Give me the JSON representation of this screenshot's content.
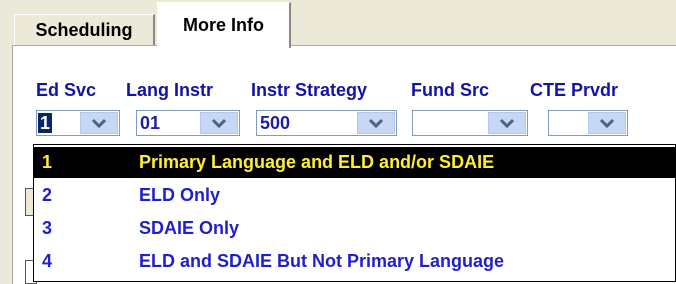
{
  "tabs": [
    {
      "label": "Scheduling"
    },
    {
      "label": "More Info"
    }
  ],
  "fields": [
    {
      "header": "Ed Svc",
      "value": "1"
    },
    {
      "header": "Lang Instr",
      "value": "01"
    },
    {
      "header": "Instr Strategy",
      "value": "500"
    },
    {
      "header": "Fund Src",
      "value": ""
    },
    {
      "header": "CTE Prvdr",
      "value": ""
    }
  ],
  "dropdown": {
    "options": [
      {
        "code": "1",
        "label": "Primary Language and ELD and/or SDAIE",
        "selected": true
      },
      {
        "code": "2",
        "label": "ELD Only",
        "selected": false
      },
      {
        "code": "3",
        "label": "SDAIE Only",
        "selected": false
      },
      {
        "code": "4",
        "label": "ELD and SDAIE But Not Primary Language",
        "selected": false
      }
    ]
  },
  "colors": {
    "header_text": "#1313a8",
    "option_text": "#1f1fcc",
    "selected_bg": "#000000",
    "selected_text": "#ffef33"
  }
}
